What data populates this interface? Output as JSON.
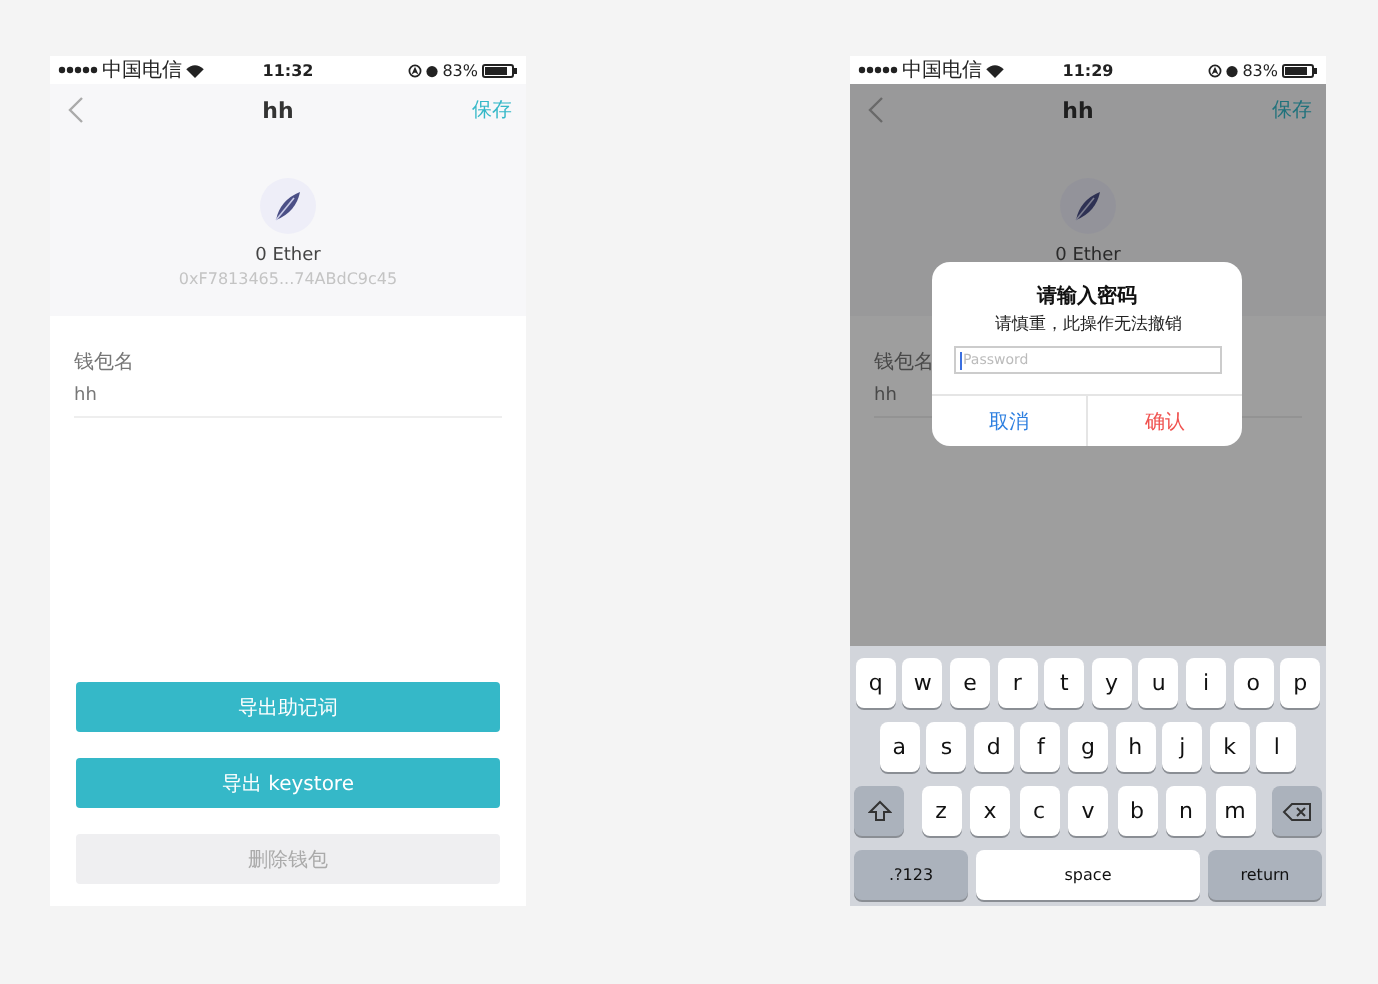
{
  "screens": [
    {
      "status_bar": {
        "carrier": "中国电信",
        "time": "11:32",
        "battery": "83%"
      },
      "nav": {
        "title": "hh",
        "action": "保存"
      },
      "wallet": {
        "balance": "0 Ether",
        "address": "0xF7813465...74ABdC9c45"
      },
      "form": {
        "label": "钱包名",
        "value": "hh"
      },
      "buttons": [
        {
          "label": "导出助记词",
          "kind": "primary"
        },
        {
          "label": "导出 keystore",
          "kind": "primary"
        },
        {
          "label": "删除钱包",
          "kind": "disabled"
        }
      ]
    },
    {
      "status_bar": {
        "carrier": "中国电信",
        "time": "11:29",
        "battery": "83%"
      },
      "nav": {
        "title": "hh",
        "action": "保存"
      },
      "wallet": {
        "balance": "0 Ether"
      },
      "form": {
        "label": "钱包名",
        "value": "hh"
      },
      "dialog": {
        "title": "请输入密码",
        "message": "请慎重，此操作无法撤销",
        "field": {
          "placeholder": "Password",
          "focused": true
        },
        "actions": [
          {
            "label": "取消",
            "kind": "cancel"
          },
          {
            "label": "确认",
            "kind": "confirm"
          }
        ]
      },
      "keyboard": [
        [
          {
            "label": "q",
            "kind": "letter"
          },
          {
            "label": "w",
            "kind": "letter"
          },
          {
            "label": "e",
            "kind": "letter"
          },
          {
            "label": "r",
            "kind": "letter"
          },
          {
            "label": "t",
            "kind": "letter"
          },
          {
            "label": "y",
            "kind": "letter"
          },
          {
            "label": "u",
            "kind": "letter"
          },
          {
            "label": "i",
            "kind": "letter"
          },
          {
            "label": "o",
            "kind": "letter"
          },
          {
            "label": "p",
            "kind": "letter"
          }
        ],
        [
          {
            "label": "a",
            "kind": "letter"
          },
          {
            "label": "s",
            "kind": "letter"
          },
          {
            "label": "d",
            "kind": "letter"
          },
          {
            "label": "f",
            "kind": "letter"
          },
          {
            "label": "g",
            "kind": "letter"
          },
          {
            "label": "h",
            "kind": "letter"
          },
          {
            "label": "j",
            "kind": "letter"
          },
          {
            "label": "k",
            "kind": "letter"
          },
          {
            "label": "l",
            "kind": "letter"
          }
        ],
        [
          {
            "kind": "shift"
          },
          {
            "label": "z",
            "kind": "letter"
          },
          {
            "label": "x",
            "kind": "letter"
          },
          {
            "label": "c",
            "kind": "letter"
          },
          {
            "label": "v",
            "kind": "letter"
          },
          {
            "label": "b",
            "kind": "letter"
          },
          {
            "label": "n",
            "kind": "letter"
          },
          {
            "label": "m",
            "kind": "letter"
          },
          {
            "kind": "delete"
          }
        ],
        [
          {
            "label": ".?123",
            "kind": "mode"
          },
          {
            "label": "space",
            "kind": "space"
          },
          {
            "label": "return",
            "kind": "return"
          }
        ]
      ]
    }
  ]
}
